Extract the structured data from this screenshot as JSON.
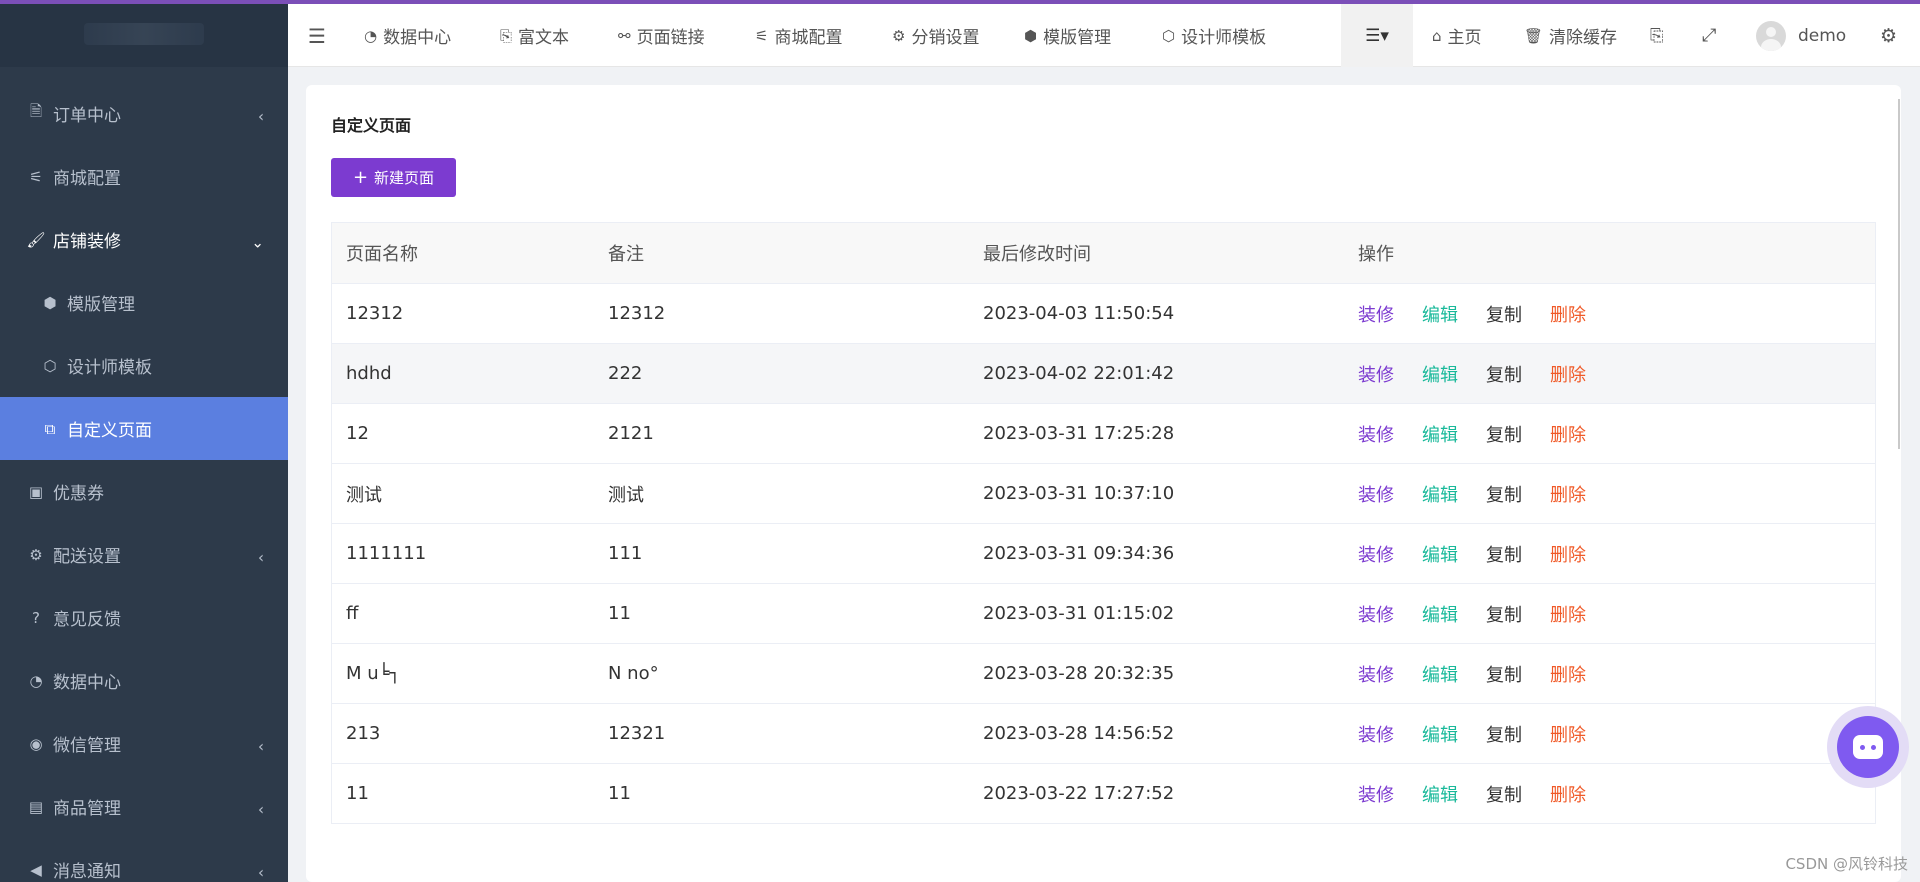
{
  "colors": {
    "accent": "#7c3bd0",
    "sidebar_bg": "#2d3a4a",
    "sidebar_active": "#5b7fe0",
    "edit": "#19b99a",
    "delete": "#f05a28"
  },
  "sidebar": {
    "items": [
      {
        "icon": "file-icon",
        "glyph": "🗎",
        "label": "订单中心",
        "caret": "‹"
      },
      {
        "icon": "sliders-icon",
        "glyph": "⚟",
        "label": "商城配置",
        "caret": ""
      },
      {
        "icon": "paintbrush-icon",
        "glyph": "🖌",
        "label": "店铺装修",
        "caret": "⌄"
      },
      {
        "icon": "cubes-icon",
        "glyph": "⬢",
        "label": "模版管理",
        "caret": ""
      },
      {
        "icon": "cube-icon",
        "glyph": "⬡",
        "label": "设计师模板",
        "caret": ""
      },
      {
        "icon": "copy-icon",
        "glyph": "⧉",
        "label": "自定义页面",
        "caret": ""
      },
      {
        "icon": "money-icon",
        "glyph": "▣",
        "label": "优惠券",
        "caret": ""
      },
      {
        "icon": "gears-icon",
        "glyph": "⚙",
        "label": "配送设置",
        "caret": "‹"
      },
      {
        "icon": "question-icon",
        "glyph": "?",
        "label": "意见反馈",
        "caret": ""
      },
      {
        "icon": "dashboard-icon",
        "glyph": "◔",
        "label": "数据中心",
        "caret": ""
      },
      {
        "icon": "wechat-icon",
        "glyph": "◉",
        "label": "微信管理",
        "caret": "‹"
      },
      {
        "icon": "archive-icon",
        "glyph": "▤",
        "label": "商品管理",
        "caret": "‹"
      },
      {
        "icon": "bullhorn-icon",
        "glyph": "◀",
        "label": "消息通知",
        "caret": "‹"
      }
    ]
  },
  "topbar": {
    "menu_glyph": "☰",
    "items": [
      {
        "icon": "dashboard-icon",
        "glyph": "◔",
        "label": "数据中心"
      },
      {
        "icon": "translate-icon",
        "glyph": "⎘",
        "label": "富文本"
      },
      {
        "icon": "unlink-icon",
        "glyph": "⚯",
        "label": "页面链接"
      },
      {
        "icon": "sliders-icon",
        "glyph": "⚟",
        "label": "商城配置"
      },
      {
        "icon": "gear-icon",
        "glyph": "⚙",
        "label": "分销设置"
      },
      {
        "icon": "cubes-icon",
        "glyph": "⬢",
        "label": "模版管理"
      },
      {
        "icon": "cube-icon",
        "glyph": "⬡",
        "label": "设计师模板"
      }
    ],
    "list_glyph": "☰▾",
    "home": {
      "glyph": "⌂",
      "label": "主页"
    },
    "clear_cache": {
      "glyph": "🗑",
      "label": "清除缓存"
    },
    "translate_glyph": "⎘",
    "fullscreen_glyph": "⤢",
    "user": "demo",
    "settings_glyph": "⚙"
  },
  "main": {
    "title": "自定义页面",
    "new_button": {
      "plus": "+",
      "label": "新建页面"
    },
    "table": {
      "headers": [
        "页面名称",
        "备注",
        "最后修改时间",
        "操作"
      ],
      "actions": {
        "decorate": "装修",
        "edit": "编辑",
        "copy": "复制",
        "delete": "删除"
      },
      "rows": [
        {
          "name": "12312",
          "note": "12312",
          "time": "2023-04-03 11:50:54"
        },
        {
          "name": "hdhd",
          "note": "222",
          "time": "2023-04-02 22:01:42"
        },
        {
          "name": "12",
          "note": "2121",
          "time": "2023-03-31 17:25:28"
        },
        {
          "name": "测试",
          "note": "测试",
          "time": "2023-03-31 10:37:10"
        },
        {
          "name": "1111111",
          "note": "111",
          "time": "2023-03-31 09:34:36"
        },
        {
          "name": "ff",
          "note": "11",
          "time": "2023-03-31 01:15:02"
        },
        {
          "name": "M u╘┐",
          "note": "N no°",
          "time": "2023-03-28 20:32:35"
        },
        {
          "name": "213",
          "note": "12321",
          "time": "2023-03-28 14:56:52"
        },
        {
          "name": "11",
          "note": "11",
          "time": "2023-03-22 17:27:52"
        }
      ]
    }
  },
  "watermark": "CSDN @风铃科技"
}
